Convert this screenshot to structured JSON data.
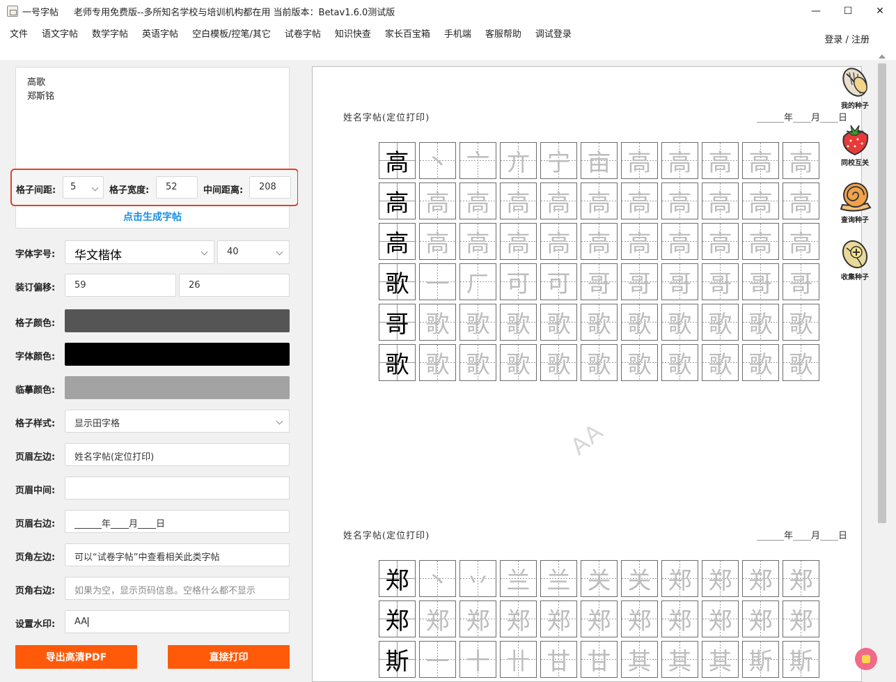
{
  "window": {
    "app_name": "一号字帖",
    "title": "老师专用免费版--多所知名学校与培训机构都在用 当前版本：Betav1.6.0测试版",
    "minimize": "—",
    "maximize": "☐",
    "close": "✕"
  },
  "menu": {
    "items": [
      "文件",
      "语文字帖",
      "数学字帖",
      "英语字帖",
      "空白模板/控笔/其它",
      "试卷字帖",
      "知识快查",
      "家长百宝箱",
      "手机端",
      "客服帮助",
      "调试登录"
    ],
    "login": "登录 / 注册"
  },
  "input_text": {
    "lines": [
      "高歌",
      "郑斯铭"
    ]
  },
  "grid_settings": {
    "gap_label": "格子间距:",
    "gap_value": "5",
    "width_label": "格子宽度:",
    "width_value": "52",
    "middle_label": "中间距离:",
    "middle_value": "208"
  },
  "generate_link": "点击生成字帖",
  "settings": {
    "font_label": "字体字号:",
    "font_value": "华文楷体",
    "size_value": "40",
    "binding_label": "装订偏移:",
    "binding_x": "59",
    "binding_y": "26",
    "grid_color_label": "格子颜色:",
    "grid_color": "#555555",
    "font_color_label": "字体颜色:",
    "font_color": "#000000",
    "trace_color_label": "临摹颜色:",
    "trace_color": "#a3a3a3",
    "style_label": "格子样式:",
    "style_value": "显示田字格",
    "header_left_label": "页眉左边:",
    "header_left_value": "姓名字帖(定位打印)",
    "header_middle_label": "页眉中间:",
    "header_middle_value": "",
    "header_right_label": "页眉右边:",
    "header_right_value": "______年____月____日",
    "footer_left_label": "页角左边:",
    "footer_left_value": "可以“试卷字帖”中查看相关此类字帖",
    "footer_right_label": "页角右边:",
    "footer_right_placeholder": "如果为空，显示页码信息。空格什么都不显示",
    "watermark_label": "设置水印:",
    "watermark_value": "AA"
  },
  "buttons": {
    "export_pdf": "导出高清PDF",
    "print": "直接打印"
  },
  "accent_color": "#ff5a0a",
  "highlight_color": "#e0412a",
  "preview": {
    "header_left": "姓名字帖(定位打印)",
    "header_right": "______年____月____日",
    "watermark": "AA",
    "block1": {
      "rows": [
        [
          "高",
          "丶",
          "亠",
          "亣",
          "宁",
          "亩",
          "高",
          "高",
          "高",
          "高",
          "高"
        ],
        [
          "高",
          "高",
          "高",
          "高",
          "高",
          "高",
          "高",
          "高",
          "高",
          "高",
          "高"
        ],
        [
          "高",
          "高",
          "高",
          "高",
          "高",
          "高",
          "高",
          "高",
          "高",
          "高",
          "高"
        ],
        [
          "歌",
          "一",
          "ㄏ",
          "可",
          "可",
          "哥",
          "哥",
          "哥",
          "哥",
          "哥",
          "哥"
        ],
        [
          "哥",
          "歌",
          "歌",
          "歌",
          "歌",
          "歌",
          "歌",
          "歌",
          "歌",
          "歌",
          "歌"
        ],
        [
          "歌",
          "歌",
          "歌",
          "歌",
          "歌",
          "歌",
          "歌",
          "歌",
          "歌",
          "歌",
          "歌"
        ]
      ]
    },
    "block2": {
      "rows": [
        [
          "郑",
          "丶",
          "丷",
          "兰",
          "兰",
          "关",
          "关",
          "郑",
          "郑",
          "郑",
          "郑"
        ],
        [
          "郑",
          "郑",
          "郑",
          "郑",
          "郑",
          "郑",
          "郑",
          "郑",
          "郑",
          "郑",
          "郑"
        ],
        [
          "斯",
          "一",
          "十",
          "卄",
          "甘",
          "甘",
          "其",
          "其",
          "其",
          "斯",
          "斯"
        ]
      ]
    }
  },
  "side_buttons": [
    {
      "label": "我的种子",
      "icon": "seed-icon"
    },
    {
      "label": "同校互关",
      "icon": "strawberry-icon"
    },
    {
      "label": "查询种子",
      "icon": "snail-icon"
    },
    {
      "label": "收集种子",
      "icon": "add-seed-icon"
    }
  ]
}
